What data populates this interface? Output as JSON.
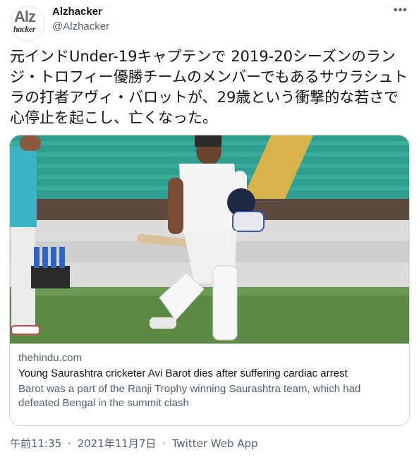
{
  "author": {
    "display_name": "Alzhacker",
    "handle": "@Alzhacker",
    "avatar_text_1": "Alz",
    "avatar_text_2": "hacker"
  },
  "more_icon": "three-dots-icon",
  "tweet": {
    "text": "元インドUnder-19キャプテンで 2019-20シーズンのランジ・トロフィー優勝チームのメンバーでもあるサウラシュトラの打者アヴィ・バロットが、29歳という衝撃的な若さで心停止を起こし、亡くなった。"
  },
  "card": {
    "domain": "thehindu.com",
    "title": "Young Saurashtra cricketer Avi Barot dies after suffering cardiac arrest",
    "description": "Barot was a part of the Ranji Trophy winning Saurashtra team, which had defeated Bengal in the summit clash"
  },
  "footer": {
    "time": "午前11:35",
    "separator": "·",
    "date": "2021年11月7日",
    "source": "Twitter Web App"
  },
  "colors": {
    "text": "#0f1419",
    "secondary": "#536471",
    "border": "#cfd9de",
    "stadium_seats": "#2a9a8c",
    "grass": "#4f7a3c"
  }
}
